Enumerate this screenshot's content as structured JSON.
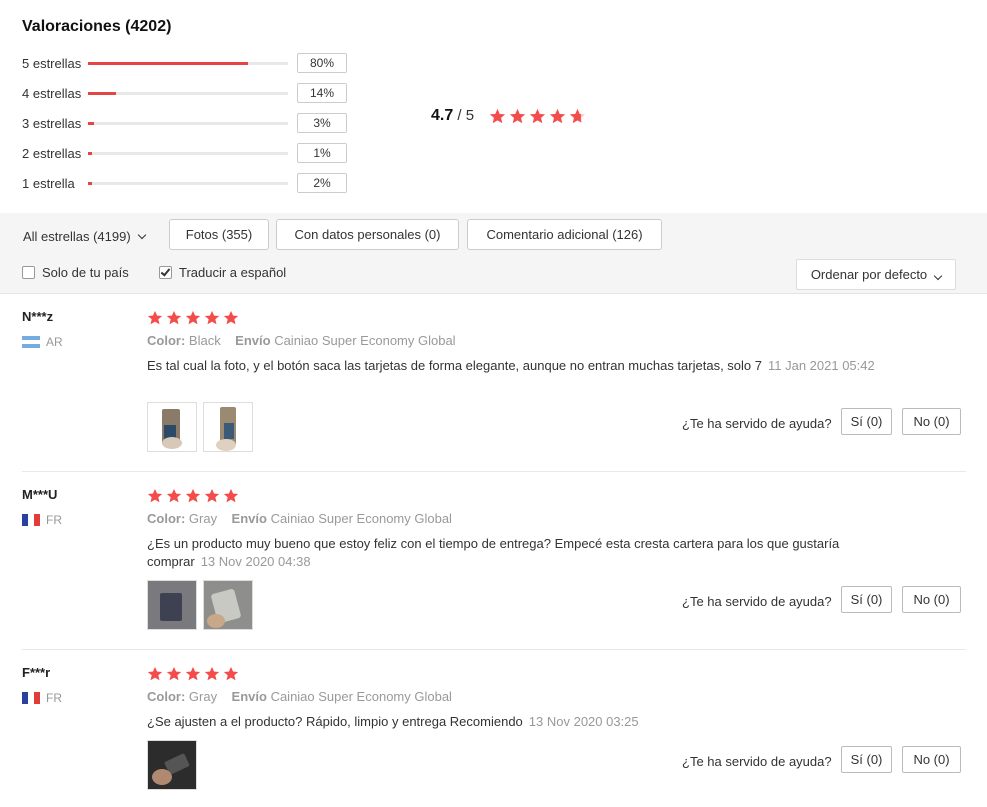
{
  "summary": {
    "title": "Valoraciones (4202)",
    "distribution": [
      {
        "label": "5 estrellas",
        "pct_text": "80%",
        "fill": 0.8
      },
      {
        "label": "4 estrellas",
        "pct_text": "14%",
        "fill": 0.14
      },
      {
        "label": "3 estrellas",
        "pct_text": "3%",
        "fill": 0.03
      },
      {
        "label": "2 estrellas",
        "pct_text": "1%",
        "fill": 0.01
      },
      {
        "label": "1 estrella",
        "pct_text": "2%",
        "fill": 0.02
      }
    ],
    "average": "4.7",
    "out_of": "/ 5",
    "average_stars": 4.7
  },
  "filters": {
    "all_stars": "All estrellas (4199)",
    "photos": "Fotos (355)",
    "personal": "Con datos personales (0)",
    "additional": "Comentario adicional (126)",
    "only_country": "Solo de tu país",
    "translate": "Traducir a español",
    "sort": "Ordenar por defecto"
  },
  "reviews": [
    {
      "name": "N***z",
      "country": "AR",
      "stars": 5,
      "color_label": "Color:",
      "color": "Black",
      "shipping_label": "Envío",
      "shipping": "Cainiao Super Economy Global",
      "text": "Es tal cual la foto, y el botón saca las tarjetas de forma elegante, aunque no entran muchas tarjetas, solo 7",
      "date": "11 Jan 2021 05:42",
      "helpful_q": "¿Te ha servido de ayuda?",
      "yes": "Sí (0)",
      "no": "No (0)"
    },
    {
      "name": "M***U",
      "country": "FR",
      "stars": 5,
      "color_label": "Color:",
      "color": "Gray",
      "shipping_label": "Envío",
      "shipping": "Cainiao Super Economy Global",
      "text": "¿Es un producto muy bueno que estoy feliz con el tiempo de entrega? Empecé esta cresta cartera para los que gustaría comprar",
      "date": "13 Nov 2020 04:38",
      "helpful_q": "¿Te ha servido de ayuda?",
      "yes": "Sí (0)",
      "no": "No (0)"
    },
    {
      "name": "F***r",
      "country": "FR",
      "stars": 5,
      "color_label": "Color:",
      "color": "Gray",
      "shipping_label": "Envío",
      "shipping": "Cainiao Super Economy Global",
      "text": "¿Se ajusten a el producto? Rápido, limpio y entrega Recomiendo",
      "date": "13 Nov 2020 03:25",
      "helpful_q": "¿Te ha servido de ayuda?",
      "yes": "Sí (0)",
      "no": "No (0)"
    }
  ],
  "colors": {
    "accent": "#f44b4b",
    "bar_fill": "#e64545"
  }
}
